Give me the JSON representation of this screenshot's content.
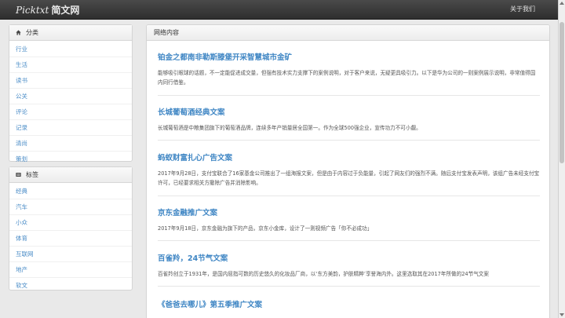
{
  "header": {
    "brand_latin": "Picktxt",
    "brand_cn": "简文网",
    "about_link": "关于我们"
  },
  "sidebar": {
    "categories": {
      "title": "分类",
      "icon": "home-icon",
      "items": [
        "行业",
        "生活",
        "读书",
        "公关",
        "评论",
        "记录",
        "清尚",
        "策划"
      ]
    },
    "tags": {
      "title": "标签",
      "icon": "tag-icon",
      "items": [
        "经典",
        "汽车",
        "小众",
        "体育",
        "互联网",
        "地产",
        "软文"
      ]
    }
  },
  "main": {
    "title": "网络内容",
    "articles": [
      {
        "title": "铂金之都南非勒斯滕堡开采智慧城市金矿",
        "summary": "能够吸引眼球的话题，不一定能促进成交量，但强有技术实力支撑下的案例说明，对于客户来说，无疑更具吸引力。以下是华为公司的一则案例展示说明，非常值得国内同行借鉴。"
      },
      {
        "title": "长城葡萄酒经典文案",
        "summary": "长城葡萄酒是中粮集团旗下的葡萄酒品牌，连续多年产销量居全国第一。作为全球500强企业，宣传功力不可小觑。"
      },
      {
        "title": "蚂蚁财富扎心广告文案",
        "summary": "2017年9月28日，支付宝联合了16家基金公司推出了一组海报文案，但是由于内容过于负能量，引起了网友们的强烈不满。随后支付宝发表声明，该组广告未经支付宝许可，已经要求相关方撤除广告并消除影响。"
      },
      {
        "title": "京东金融推广文案",
        "summary": "2017年9月18日，京东金融为旗下的产品，京东小金库，设计了一则视频广告「你不必成功」"
      },
      {
        "title": "百雀羚，24节气文案",
        "summary": "百雀羚创立于1931年，是国内屈指可数的历史悠久的化妆品厂商，以‘东方美韵，护肤精粹’享誉海内外。这里选取其在2017年所做的24节气文案"
      },
      {
        "title": "《爸爸去哪儿》第五季推广文案",
        "summary": ""
      }
    ]
  }
}
